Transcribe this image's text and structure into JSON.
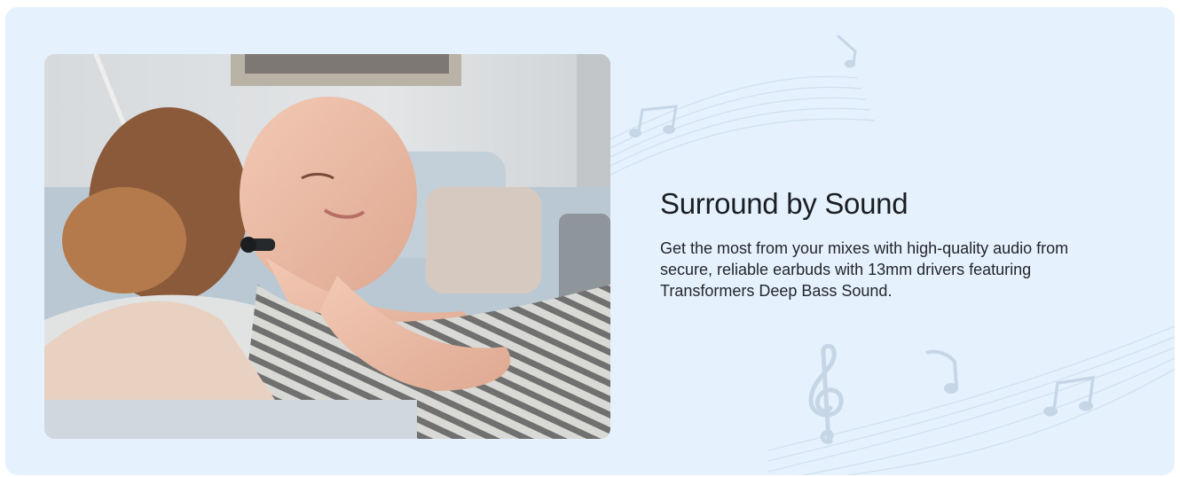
{
  "feature": {
    "title": "Surround by Sound",
    "description": "Get the most from your mixes with high-quality audio from secure, reliable earbuds with 13mm drivers featuring Transformers Deep Bass Sound."
  },
  "colors": {
    "card_background": "#e5f1fd",
    "decoration": "#c9d9e8",
    "text_primary": "#1b1e22"
  },
  "icons": [
    "music-note-icon",
    "treble-clef-icon"
  ]
}
